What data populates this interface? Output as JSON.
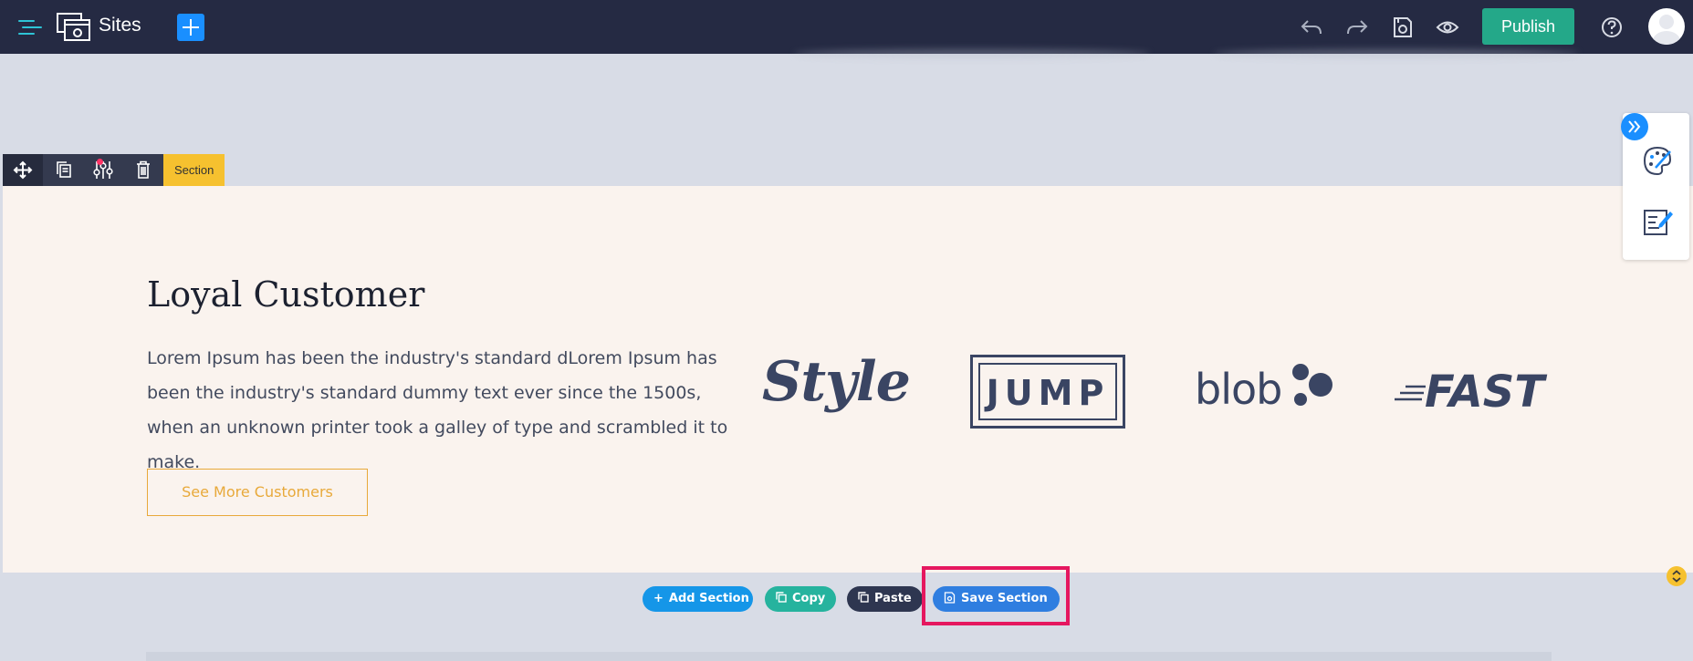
{
  "topbar": {
    "title": "Sites",
    "publish_label": "Publish",
    "icons": [
      "menu-icon",
      "sites-logo-icon",
      "add-icon",
      "undo-icon",
      "redo-icon",
      "save-icon",
      "preview-icon",
      "help-icon",
      "avatar"
    ]
  },
  "section_toolbar": {
    "label": "Section",
    "buttons": [
      "move-icon",
      "duplicate-icon",
      "settings-icon",
      "delete-icon"
    ]
  },
  "section": {
    "heading": "Loyal Customer",
    "paragraph": "Lorem Ipsum has been the industry's standard dLorem Ipsum has been the industry's standard dummy text ever since the 1500s, when an unknown printer took a galley of type and scrambled it to make.",
    "button_label": "See More Customers",
    "logos": {
      "style": "Style",
      "jump": "JUMP",
      "blob": "blob",
      "fast": "FAST"
    }
  },
  "actions": {
    "add_section": "Add Section",
    "copy": "Copy",
    "paste": "Paste",
    "save_section": "Save Section"
  },
  "colors": {
    "topbar_bg": "#252a43",
    "publish_bg": "#24a889",
    "accent_yellow": "#f6c12f",
    "highlight": "#e5175f"
  }
}
